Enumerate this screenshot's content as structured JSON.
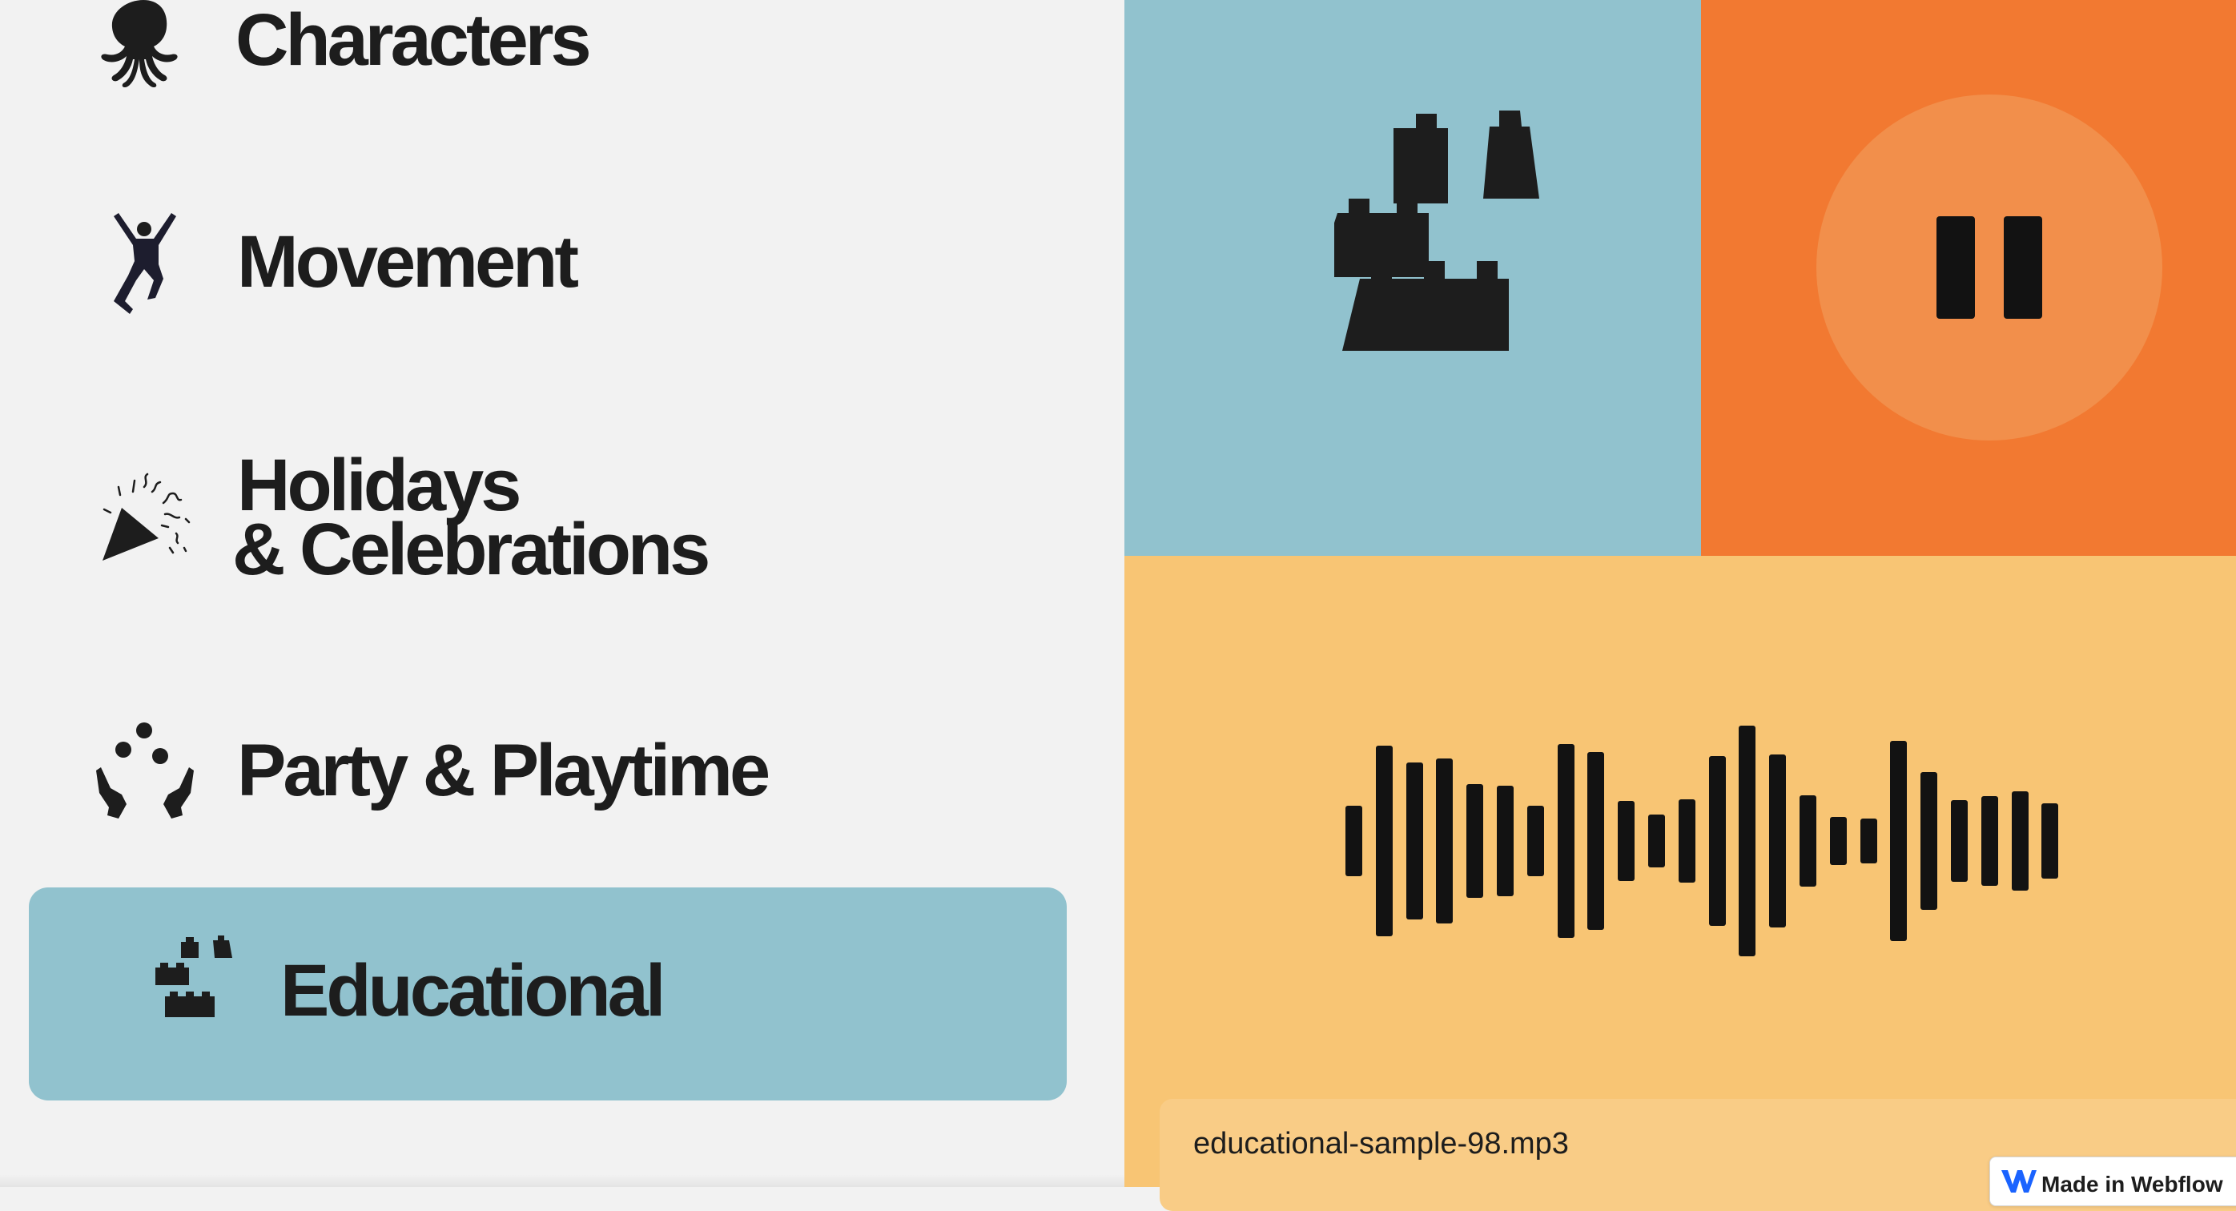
{
  "categories": [
    {
      "label": "Characters",
      "icon": "octopus-icon"
    },
    {
      "label": "Movement",
      "icon": "jumping-person-icon"
    },
    {
      "label_line1": "Holidays",
      "label_line2": "& Celebrations",
      "icon": "party-popper-icon"
    },
    {
      "label": "Party & Playtime",
      "icon": "juggling-hands-icon"
    },
    {
      "label": "Educational",
      "icon": "building-blocks-icon",
      "selected": true
    }
  ],
  "player": {
    "state": "playing",
    "control_icon": "pause-icon",
    "file_name": "educational-sample-98.mp3",
    "waveform_icon": "waveform-icon"
  },
  "badge": {
    "text": "Made in Webflow",
    "icon": "webflow-logo-icon"
  },
  "colors": {
    "background": "#f2f2f2",
    "blue": "#91c2ce",
    "orange": "#f27931",
    "pause_circle": "#f28f4b",
    "yellow": "#f8c574",
    "ink": "#1d1d1d"
  }
}
